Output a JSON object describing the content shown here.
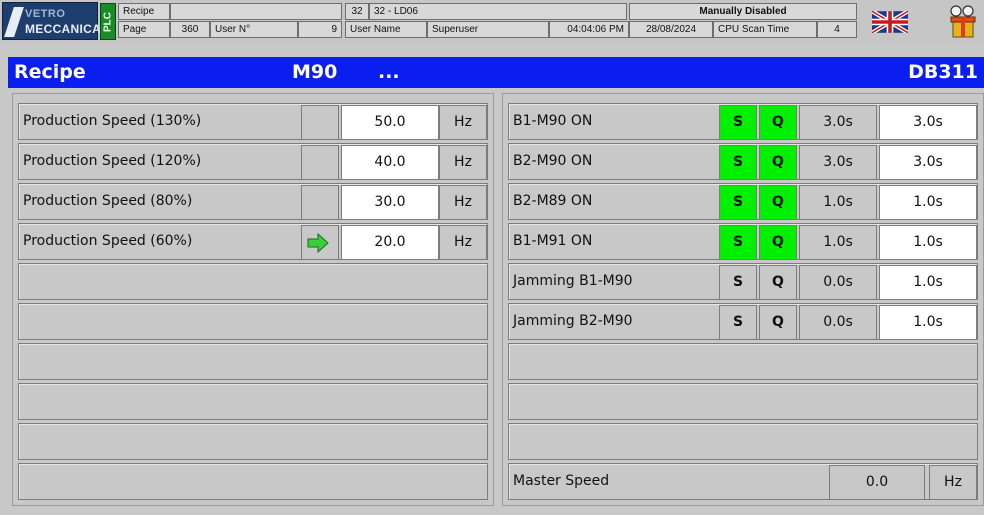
{
  "header": {
    "logo": {
      "line1": "VETRO",
      "line2": "MECCANICA"
    },
    "plc_label": "PLC",
    "row1": {
      "recipe_label": "Recipe",
      "line_number": "32",
      "line_name": "32 - LD06",
      "status": "Manually Disabled"
    },
    "row2": {
      "page_label": "Page",
      "page_number": "360",
      "user_no_label": "User N°",
      "user_no": "9",
      "user_name_label": "User Name",
      "user_name": "Superuser",
      "time": "04:04:06 PM",
      "date": "28/08/2024",
      "cpu_label": "CPU Scan Time",
      "cpu_value": "4"
    },
    "flag_icon": "uk-flag-icon",
    "menu_icon": "users-gift-icon"
  },
  "title": {
    "left": "Recipe",
    "center": "M90",
    "dots": "...",
    "right": "DB311"
  },
  "speeds": [
    {
      "label": "Production Speed (130%)",
      "value": "50.0",
      "unit": "Hz",
      "active": false
    },
    {
      "label": "Production Speed (120%)",
      "value": "40.0",
      "unit": "Hz",
      "active": false
    },
    {
      "label": "Production Speed (80%)",
      "value": "30.0",
      "unit": "Hz",
      "active": false
    },
    {
      "label": "Production Speed (60%)",
      "value": "20.0",
      "unit": "Hz",
      "active": true
    }
  ],
  "timers": [
    {
      "label": "B1-M90 ON",
      "s": "S",
      "q": "Q",
      "actual": "3.0s",
      "setpoint": "3.0s",
      "on": true
    },
    {
      "label": "B2-M90 ON",
      "s": "S",
      "q": "Q",
      "actual": "3.0s",
      "setpoint": "3.0s",
      "on": true
    },
    {
      "label": "B2-M89 ON",
      "s": "S",
      "q": "Q",
      "actual": "1.0s",
      "setpoint": "1.0s",
      "on": true
    },
    {
      "label": "B1-M91 ON",
      "s": "S",
      "q": "Q",
      "actual": "1.0s",
      "setpoint": "1.0s",
      "on": true
    },
    {
      "label": "Jamming B1-M90",
      "s": "S",
      "q": "Q",
      "actual": "0.0s",
      "setpoint": "1.0s",
      "on": false
    },
    {
      "label": "Jamming B2-M90",
      "s": "S",
      "q": "Q",
      "actual": "0.0s",
      "setpoint": "1.0s",
      "on": false
    }
  ],
  "master_speed": {
    "label": "Master Speed",
    "value": "0.0",
    "unit": "Hz"
  },
  "colors": {
    "title_bg": "#0a1ef0",
    "active_green": "#00f000",
    "arrow_green": "#39d039",
    "plc_green": "#1d8a2a"
  }
}
